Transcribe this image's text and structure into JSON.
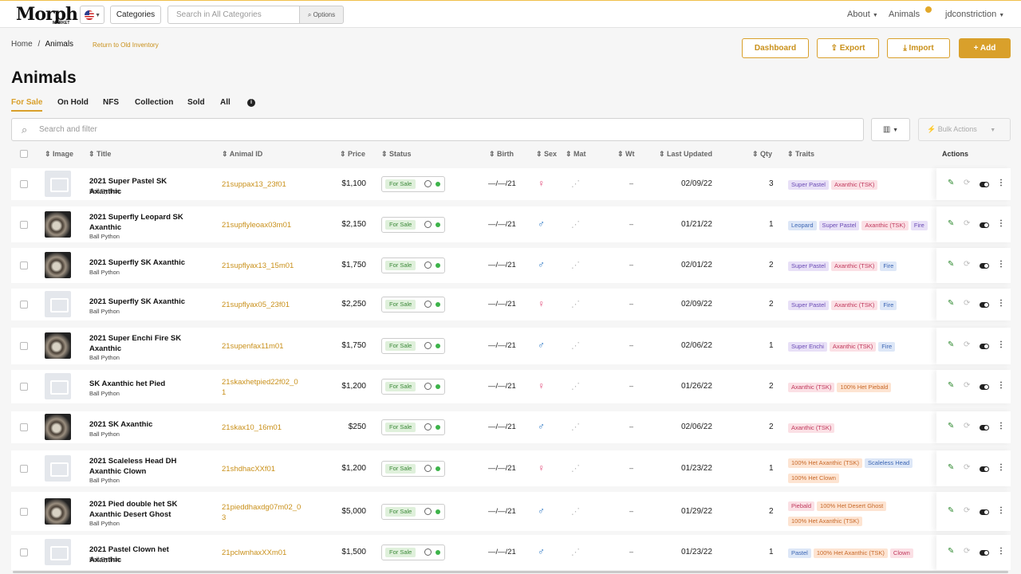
{
  "brand": {
    "logo": "Morph",
    "sub": "MARKET"
  },
  "topnav": {
    "categories_label": "Categories",
    "search_placeholder": "Search in All Categories",
    "options_label": "Options",
    "about_label": "About",
    "animals_label": "Animals",
    "user_label": "jdconstriction"
  },
  "breadcrumb": {
    "home": "Home",
    "sep": "/",
    "current": "Animals",
    "return_link": "Return to Old Inventory"
  },
  "toolbar": {
    "dashboard": "Dashboard",
    "export": "Export",
    "import": "Import",
    "add": "Add"
  },
  "page_title": "Animals",
  "tabs": [
    "For Sale",
    "On Hold",
    "NFS",
    "Collection",
    "Sold",
    "All"
  ],
  "filter_placeholder": "Search and filter",
  "bulk_actions": "Bulk Actions",
  "columns": {
    "image": "Image",
    "title": "Title",
    "animal_id": "Animal ID",
    "price": "Price",
    "status": "Status",
    "birth": "Birth",
    "sex": "Sex",
    "mat": "Mat",
    "wt": "Wt",
    "last_updated": "Last Updated",
    "qty": "Qty",
    "traits": "Traits",
    "actions": "Actions"
  },
  "colors": {
    "accent": "#d9a02b",
    "status_green": "#3db34a"
  },
  "rows": [
    {
      "title": "2021 Super Pastel SK Axanthic",
      "species": "Ball Python",
      "id": "21suppax13_23f01",
      "price": "$1,100",
      "status": "For Sale",
      "birth": "—/—/21",
      "sex": "♀",
      "sex_kind": "f",
      "wt": "–",
      "updated": "02/09/22",
      "qty": "3",
      "image": "placeholder",
      "traits": [
        {
          "t": "Super Pastel",
          "c": "purple"
        },
        {
          "t": "Axanthic (TSK)",
          "c": "pink"
        }
      ]
    },
    {
      "title": "2021 Superfly Leopard SK Axanthic",
      "species": "Ball Python",
      "id": "21supflyleoax03m01",
      "price": "$2,150",
      "status": "For Sale",
      "birth": "—/—/21",
      "sex": "♂",
      "sex_kind": "m",
      "wt": "–",
      "updated": "01/21/22",
      "qty": "1",
      "image": "photo",
      "traits": [
        {
          "t": "Leopard",
          "c": "blue"
        },
        {
          "t": "Super Pastel",
          "c": "purple"
        },
        {
          "t": "Axanthic (TSK)",
          "c": "pink"
        },
        {
          "t": "Fire",
          "c": "purple"
        }
      ]
    },
    {
      "title": "2021 Superfly SK Axanthic",
      "species": "Ball Python",
      "id": "21supflyax13_15m01",
      "price": "$1,750",
      "status": "For Sale",
      "birth": "—/—/21",
      "sex": "♂",
      "sex_kind": "m",
      "wt": "–",
      "updated": "02/01/22",
      "qty": "2",
      "image": "photo",
      "traits": [
        {
          "t": "Super Pastel",
          "c": "purple"
        },
        {
          "t": "Axanthic (TSK)",
          "c": "pink"
        },
        {
          "t": "Fire",
          "c": "blue"
        }
      ]
    },
    {
      "title": "2021 Superfly SK Axanthic",
      "species": "Ball Python",
      "id": "21supflyax05_23f01",
      "price": "$2,250",
      "status": "For Sale",
      "birth": "—/—/21",
      "sex": "♀",
      "sex_kind": "f",
      "wt": "–",
      "updated": "02/09/22",
      "qty": "2",
      "image": "placeholder",
      "traits": [
        {
          "t": "Super Pastel",
          "c": "purple"
        },
        {
          "t": "Axanthic (TSK)",
          "c": "pink"
        },
        {
          "t": "Fire",
          "c": "blue"
        }
      ]
    },
    {
      "title": "2021 Super Enchi Fire SK Axanthic",
      "species": "Ball Python",
      "id": "21supenfax11m01",
      "price": "$1,750",
      "status": "For Sale",
      "birth": "—/—/21",
      "sex": "♂",
      "sex_kind": "m",
      "wt": "–",
      "updated": "02/06/22",
      "qty": "1",
      "image": "photo",
      "traits": [
        {
          "t": "Super Enchi",
          "c": "purple"
        },
        {
          "t": "Axanthic (TSK)",
          "c": "pink"
        },
        {
          "t": "Fire",
          "c": "blue"
        }
      ]
    },
    {
      "title": "SK Axanthic het Pied",
      "species": "Ball Python",
      "id": "21skaxhetpied22f02_01",
      "price": "$1,200",
      "status": "For Sale",
      "birth": "—/—/21",
      "sex": "♀",
      "sex_kind": "f",
      "wt": "–",
      "updated": "01/26/22",
      "qty": "2",
      "image": "placeholder",
      "traits": [
        {
          "t": "Axanthic (TSK)",
          "c": "pink"
        },
        {
          "t": "100% Het Piebald",
          "c": "orange"
        }
      ]
    },
    {
      "title": "2021 SK Axanthic",
      "species": "Ball Python",
      "id": "21skax10_16m01",
      "price": "$250",
      "status": "For Sale",
      "birth": "—/—/21",
      "sex": "♂",
      "sex_kind": "m",
      "wt": "–",
      "updated": "02/06/22",
      "qty": "2",
      "image": "photo",
      "traits": [
        {
          "t": "Axanthic (TSK)",
          "c": "pink"
        }
      ]
    },
    {
      "title": "2021 Scaleless Head DH Axanthic Clown",
      "species": "Ball Python",
      "id": "21shdhacXXf01",
      "price": "$1,200",
      "status": "For Sale",
      "birth": "—/—/21",
      "sex": "♀",
      "sex_kind": "f",
      "wt": "–",
      "updated": "01/23/22",
      "qty": "1",
      "image": "placeholder",
      "traits": [
        {
          "t": "100% Het Axanthic (TSK)",
          "c": "orange"
        },
        {
          "t": "Scaleless Head",
          "c": "blue"
        },
        {
          "t": "100% Het Clown",
          "c": "orange"
        }
      ]
    },
    {
      "title": "2021 Pied double het SK Axanthic Desert Ghost",
      "species": "Ball Python",
      "id": "21pieddhaxdg07m02_03",
      "price": "$5,000",
      "status": "For Sale",
      "birth": "—/—/21",
      "sex": "♂",
      "sex_kind": "m",
      "wt": "–",
      "updated": "01/29/22",
      "qty": "2",
      "image": "photo",
      "traits": [
        {
          "t": "Piebald",
          "c": "pink"
        },
        {
          "t": "100% Het Desert Ghost",
          "c": "orange"
        },
        {
          "t": "100% Het Axanthic (TSK)",
          "c": "orange"
        }
      ]
    },
    {
      "title": "2021 Pastel Clown het Axanthic",
      "species": "Ball Python",
      "id": "21pclwnhaxXXm01",
      "price": "$1,500",
      "status": "For Sale",
      "birth": "—/—/21",
      "sex": "♂",
      "sex_kind": "m",
      "wt": "–",
      "updated": "01/23/22",
      "qty": "1",
      "image": "placeholder",
      "traits": [
        {
          "t": "Pastel",
          "c": "blue"
        },
        {
          "t": "100% Het Axanthic (TSK)",
          "c": "orange"
        },
        {
          "t": "Clown",
          "c": "pink"
        }
      ]
    }
  ]
}
